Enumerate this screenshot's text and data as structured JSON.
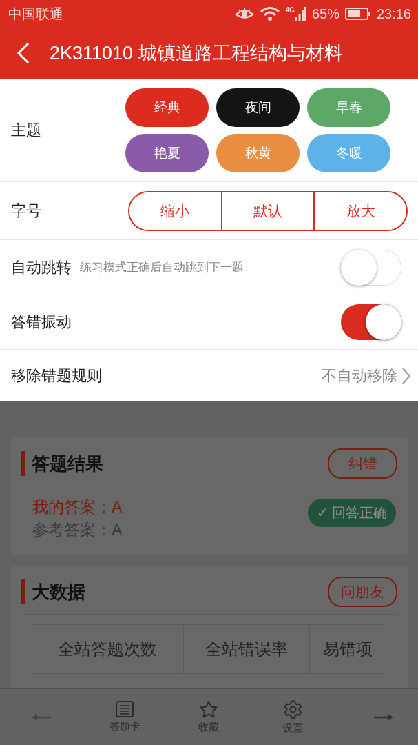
{
  "status_bar": {
    "carrier": "中国联通",
    "network": "4G",
    "battery": "65%",
    "time": "23:16"
  },
  "header": {
    "title": "2K311010 城镇道路工程结构与材料"
  },
  "settings": {
    "theme": {
      "label": "主题",
      "options": [
        {
          "label": "经典",
          "color": "#db2c1f"
        },
        {
          "label": "夜间",
          "color": "#141414"
        },
        {
          "label": "早春",
          "color": "#5da867"
        },
        {
          "label": "艳夏",
          "color": "#8a5ba8"
        },
        {
          "label": "秋黄",
          "color": "#e88d42"
        },
        {
          "label": "冬暖",
          "color": "#5db2e8"
        }
      ]
    },
    "font_size": {
      "label": "字号",
      "options": [
        "缩小",
        "默认",
        "放大"
      ]
    },
    "auto_jump": {
      "label": "自动跳转",
      "description": "练习模式正确后自动跳到下一题",
      "on": false
    },
    "vibration": {
      "label": "答错振动",
      "on": true
    },
    "remove_rule": {
      "label": "移除错题规则",
      "value": "不自动移除"
    }
  },
  "answer_result": {
    "title": "答题结果",
    "action": "纠错",
    "my_answer": "我的答案：A",
    "reference_answer": "参考答案：A",
    "badge": "✓ 回答正确"
  },
  "big_data": {
    "title": "大数据",
    "action": "问朋友",
    "columns": [
      "全站答题次数",
      "全站错误率",
      "易错项"
    ]
  },
  "bottom_nav": {
    "items": [
      {
        "kind": "list",
        "label": "答题卡"
      },
      {
        "kind": "star",
        "label": "收藏"
      },
      {
        "kind": "gear",
        "label": "设置"
      }
    ]
  }
}
